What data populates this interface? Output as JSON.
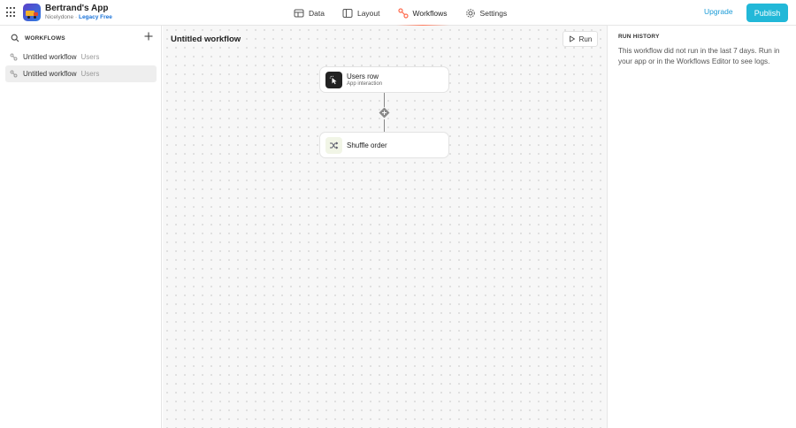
{
  "app": {
    "name": "Bertrand's App",
    "workspace": "Nicelydone",
    "separator": "·",
    "plan": "Legacy Free"
  },
  "nav": {
    "items": [
      {
        "label": "Data",
        "icon": "data-grid-icon"
      },
      {
        "label": "Layout",
        "icon": "layout-icon"
      },
      {
        "label": "Workflows",
        "icon": "workflows-icon",
        "active": true
      },
      {
        "label": "Settings",
        "icon": "gear-icon"
      }
    ]
  },
  "header": {
    "upgrade_label": "Upgrade",
    "publish_label": "Publish"
  },
  "sidebar": {
    "title": "WORKFLOWS",
    "items": [
      {
        "name": "Untitled workflow",
        "table": "Users",
        "selected": false
      },
      {
        "name": "Untitled workflow",
        "table": "Users",
        "selected": true
      }
    ]
  },
  "canvas": {
    "title": "Untitled workflow",
    "run_label": "Run",
    "trigger": {
      "title": "Users row",
      "subtitle": "App interaction"
    },
    "action": {
      "title": "Shuffle order"
    }
  },
  "history": {
    "title": "RUN HISTORY",
    "message": "This workflow did not run in the last 7 days. Run in your app or in the Workflows Editor to see logs."
  },
  "colors": {
    "accent": "#22b8d8",
    "upgrade": "#1a9bd7",
    "plan": "#1a73d9",
    "workflows_icon": "#ff6a4d"
  }
}
